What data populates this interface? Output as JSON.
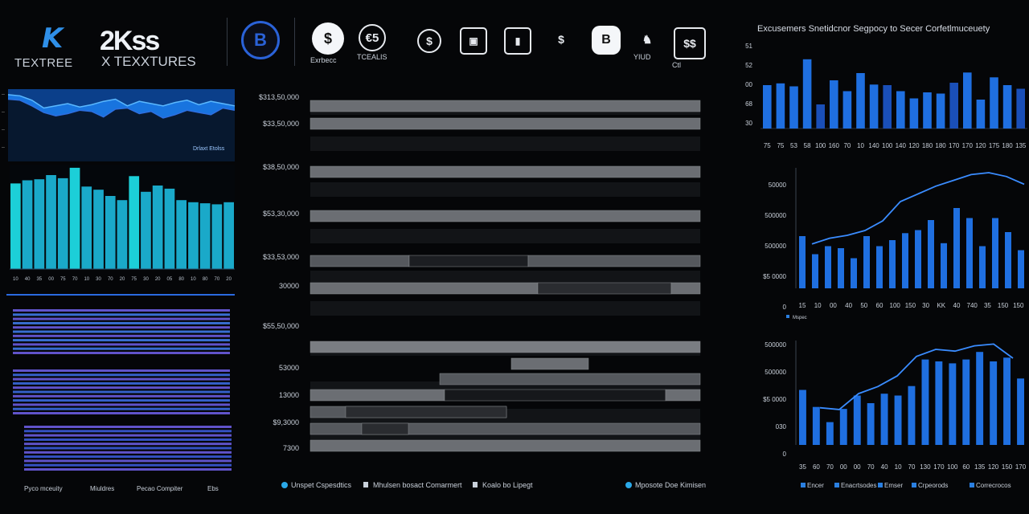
{
  "header": {
    "logo_k": "K",
    "logo_brand": "2Kss",
    "logo_sub1": "TEXTREE",
    "logo_sub2": "X TEXXTURES",
    "icons": [
      {
        "name": "bitcoin-b-icon",
        "glyph": "B",
        "label": ""
      },
      {
        "name": "dollar-coin-icon",
        "glyph": "$",
        "label": "Exrbecc"
      },
      {
        "name": "currency-c-icon",
        "glyph": "€5",
        "label": "TCEALIS"
      },
      {
        "name": "dollar-circle-icon",
        "glyph": "$",
        "label": ""
      },
      {
        "name": "bag-icon",
        "glyph": "▣",
        "label": ""
      },
      {
        "name": "wallet-icon",
        "glyph": "▮",
        "label": ""
      },
      {
        "name": "dollar-stack-icon",
        "glyph": "$",
        "label": ""
      },
      {
        "name": "bitcoin-square-icon",
        "glyph": "B",
        "label": ""
      },
      {
        "name": "chess-icon",
        "glyph": "♞",
        "label": "YIUD"
      },
      {
        "name": "cash-icon",
        "glyph": "$$",
        "label": "Ctl"
      }
    ]
  },
  "colors": {
    "accent_blue": "#1f6fe0",
    "cyan": "#22c4e0",
    "gray_bar": "#6b6e73",
    "purple": "#6a5ce0"
  },
  "chart_data": [
    {
      "id": "left-area",
      "type": "area",
      "x": [
        1,
        2,
        3,
        4,
        5,
        6,
        7,
        8,
        9,
        10,
        11,
        12,
        13,
        14,
        15,
        16,
        17,
        18,
        19,
        20
      ],
      "series": [
        {
          "values": [
            120,
            118,
            110,
            96,
            100,
            104,
            98,
            102,
            108,
            112,
            100,
            108,
            104,
            100,
            106,
            110,
            102,
            108,
            104,
            100
          ]
        },
        {
          "values": [
            112,
            110,
            100,
            88,
            82,
            86,
            92,
            90,
            80,
            94,
            96,
            86,
            90,
            78,
            84,
            92,
            88,
            84,
            96,
            92
          ]
        }
      ],
      "annotation": "Drlaxt Etolss",
      "yticks": [
        "–",
        "–",
        "–",
        "–"
      ]
    },
    {
      "id": "left-bars",
      "type": "bar",
      "categories": [
        "10",
        "40",
        "35",
        "00",
        "75",
        "70",
        "10",
        "30",
        "70",
        "20",
        "75",
        "30",
        "20",
        "05",
        "80",
        "10",
        "80",
        "70",
        "20"
      ],
      "values": [
        82,
        85,
        86,
        90,
        87,
        97,
        79,
        76,
        70,
        66,
        89,
        74,
        80,
        77,
        66,
        64,
        63,
        62,
        64
      ],
      "ylim": [
        0,
        100
      ]
    },
    {
      "id": "left-stripes",
      "type": "bar",
      "groups": [
        {
          "name": "g1",
          "bands": 11
        },
        {
          "name": "g2",
          "bands": 11
        },
        {
          "name": "g3",
          "bands": 11
        }
      ],
      "legend": [
        "Pyco mceuity",
        "Miuldres",
        "Pecao Compiter",
        "Ebs"
      ]
    },
    {
      "id": "center-gantt",
      "type": "bar",
      "categories": [
        "$313,50,000",
        "$33,50,000",
        "$38,50,000",
        "$53,30,000",
        "$33,53,000",
        "30000",
        "$55,50,000",
        "53000",
        "13000",
        "$9,3000",
        "7300"
      ],
      "legend": [
        "Unspet Cspesdtics",
        "Mhulsen bosact Comarmert",
        "Koalo bo Lipegt",
        "Mposote Doe Kimisen"
      ]
    },
    {
      "id": "right-top",
      "type": "bar",
      "title": "Excusemers Snetidcnor Segpocy to Secer Corfetlmuceuety",
      "categories": [
        "75",
        "75",
        "53",
        "58",
        "100",
        "160",
        "70",
        "10",
        "140",
        "100",
        "140",
        "120",
        "180",
        "180",
        "170",
        "170",
        "120",
        "175",
        "180",
        "135"
      ],
      "values": [
        72,
        75,
        70,
        115,
        40,
        80,
        62,
        92,
        73,
        72,
        62,
        50,
        60,
        58,
        76,
        93,
        48,
        85,
        72,
        66
      ],
      "yticks": [
        "51",
        "52",
        "00",
        "68",
        "30"
      ],
      "ylim": [
        0,
        120
      ]
    },
    {
      "id": "right-mid",
      "type": "bar",
      "categories": [
        "15",
        "10",
        "00",
        "40",
        "50",
        "60",
        "100",
        "150",
        "30",
        "KK",
        "40",
        "740",
        "35",
        "150",
        "150"
      ],
      "values": [
        52,
        34,
        42,
        40,
        30,
        52,
        42,
        48,
        55,
        58,
        68,
        45,
        80,
        70,
        42,
        70,
        56,
        38
      ],
      "line": [
        46,
        52,
        55,
        60,
        70,
        90,
        98,
        106,
        112,
        118,
        120,
        116,
        108
      ],
      "yticks": [
        "50000",
        "500000",
        "500000",
        "$5 0000",
        "0"
      ],
      "legend": [
        "Mspec"
      ]
    },
    {
      "id": "right-bot",
      "type": "bar",
      "categories": [
        "35",
        "60",
        "70",
        "00",
        "00",
        "70",
        "40",
        "10",
        "70",
        "130",
        "170",
        "100",
        "60",
        "135",
        "120",
        "150",
        "170"
      ],
      "values": [
        58,
        40,
        24,
        38,
        52,
        44,
        54,
        52,
        62,
        90,
        88,
        86,
        90,
        98,
        88,
        92,
        70
      ],
      "line": [
        42,
        40,
        58,
        66,
        78,
        100,
        108,
        106,
        112,
        114,
        98
      ],
      "yticks": [
        "500000",
        "500000",
        "$5 0000",
        "030",
        "0"
      ],
      "legend": [
        "Encer",
        "Enacrtsodes",
        "Emser",
        "Crpeorods",
        "Correcrocos"
      ]
    }
  ]
}
